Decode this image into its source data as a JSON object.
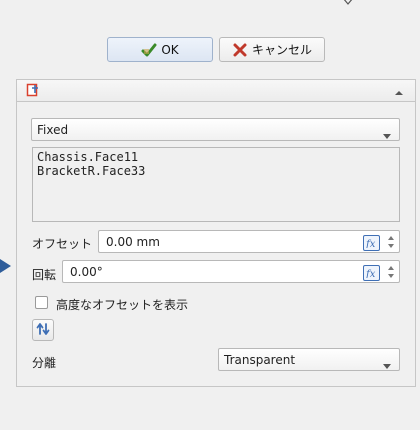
{
  "icons": {
    "top_chevron": "chevron-down-icon",
    "ok": "green-check-icon",
    "cancel": "red-x-icon",
    "panel_logo": "attachment-logo-icon",
    "collapse": "chevron-up-icon",
    "fx": "fx-expression-icon",
    "flip": "flip-arrows-icon",
    "pointer": "blue-arrow-icon"
  },
  "dialog": {
    "ok_label": "OK",
    "cancel_label": "キャンセル"
  },
  "attachment": {
    "mode": "Fixed",
    "references": [
      "Chassis.Face11",
      "BracketR.Face33"
    ],
    "offset_label": "オフセット",
    "offset_value": "0.00 mm",
    "rotation_label": "回転",
    "rotation_value": "0.00°",
    "advanced_label": "高度なオフセットを表示",
    "advanced_checked": false,
    "separation_label": "分離",
    "separation_value": "Transparent"
  },
  "colors": {
    "accent_blue": "#3f6fb5",
    "ok_green": "#3a8a2a",
    "cancel_red": "#c0392b",
    "logo_red": "#d9412e"
  }
}
